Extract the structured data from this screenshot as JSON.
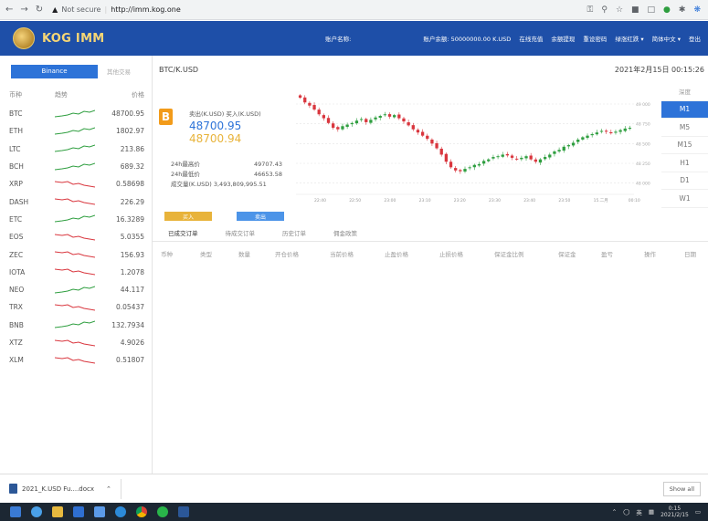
{
  "browser": {
    "security": "Not secure",
    "url": "http://imm.kog.one"
  },
  "header": {
    "brand": "KOG IMM",
    "account_label": "账户名称:",
    "balance": "账户余额: 50000000.00 K.USD",
    "links": [
      "在线充值",
      "余额提现",
      "重设密码",
      "绿涨红跌 ▾",
      "简体中文 ▾",
      "登出"
    ]
  },
  "sidebar": {
    "tab_active": "Binance",
    "tab_other": "其他交易",
    "columns": [
      "币种",
      "趋势",
      "价格"
    ],
    "rows": [
      {
        "coin": "BTC",
        "price": "48700.95",
        "trend": "up"
      },
      {
        "coin": "ETH",
        "price": "1802.97",
        "trend": "up"
      },
      {
        "coin": "LTC",
        "price": "213.86",
        "trend": "up"
      },
      {
        "coin": "BCH",
        "price": "689.32",
        "trend": "up"
      },
      {
        "coin": "XRP",
        "price": "0.58698",
        "trend": "down"
      },
      {
        "coin": "DASH",
        "price": "226.29",
        "trend": "down"
      },
      {
        "coin": "ETC",
        "price": "16.3289",
        "trend": "up"
      },
      {
        "coin": "EOS",
        "price": "5.0355",
        "trend": "down"
      },
      {
        "coin": "ZEC",
        "price": "156.93",
        "trend": "down"
      },
      {
        "coin": "IOTA",
        "price": "1.2078",
        "trend": "down"
      },
      {
        "coin": "NEO",
        "price": "44.117",
        "trend": "up"
      },
      {
        "coin": "TRX",
        "price": "0.05437",
        "trend": "down"
      },
      {
        "coin": "BNB",
        "price": "132.7934",
        "trend": "up"
      },
      {
        "coin": "XTZ",
        "price": "4.9026",
        "trend": "down"
      },
      {
        "coin": "XLM",
        "price": "0.51807",
        "trend": "down"
      }
    ]
  },
  "main": {
    "pair": "BTC/K.USD",
    "datetime": "2021年2月15日 00:15:26",
    "ticker": {
      "labels": "卖出(K.USD)    买入(K.USD)",
      "sell": "48700.95",
      "buy": "48700.94",
      "high_label": "24h最高价",
      "high": "49707.43",
      "low_label": "24h最低价",
      "low": "46653.58",
      "volume": "成交量(K.USD) 3,493,809,995.51"
    },
    "periods": [
      "深度",
      "M1",
      "M5",
      "M15",
      "H1",
      "D1",
      "W1"
    ],
    "active_period": "M1",
    "buy_btn": "买入",
    "sell_btn": "卖出",
    "order_tabs": [
      "已成交订单",
      "待成交订单",
      "历史订单",
      "佣金政策"
    ],
    "order_columns": [
      "币种",
      "类型",
      "数量",
      "开仓价格",
      "当前价格",
      "止盈价格",
      "止损价格",
      "保证金比例",
      "保证金",
      "盈亏",
      "操作",
      "日期"
    ]
  },
  "chart_data": {
    "type": "candlestick",
    "x_ticks": [
      "22:40",
      "22:50",
      "23:00",
      "23:10",
      "23:20",
      "23:30",
      "23:40",
      "23:50",
      "15.二月",
      "00:10"
    ],
    "y_ticks": [
      "49 000",
      "48 750",
      "48 500",
      "48 250",
      "48 000"
    ],
    "ylim": [
      47950,
      49150
    ],
    "series": [
      {
        "values": [
          49080,
          49020,
          48980,
          48930,
          48870,
          48820,
          48760,
          48700,
          48680,
          48720,
          48740,
          48760,
          48790,
          48810,
          48770,
          48800,
          48830,
          48850,
          48870,
          48840,
          48860,
          48820,
          48780,
          48730,
          48680,
          48640,
          48600,
          48560,
          48500,
          48440,
          48360,
          48270,
          48200,
          48160,
          48150,
          48180,
          48200,
          48230,
          48240,
          48280,
          48300,
          48330,
          48340,
          48360,
          48350,
          48320,
          48300,
          48320,
          48340,
          48300,
          48270,
          48300,
          48330,
          48360,
          48400,
          48420,
          48460,
          48480,
          48510,
          48550,
          48580,
          48600,
          48620,
          48640,
          48660,
          48650,
          48630,
          48650,
          48670,
          48690,
          48700
        ]
      }
    ]
  },
  "download": {
    "file": "2021_K.USD Fu....docx",
    "show_all": "Show all"
  },
  "taskbar": {
    "time": "0:15",
    "date": "2021/2/15",
    "ime": "英"
  },
  "colors": {
    "brand_blue": "#1e4fa8",
    "accent": "#2d73d8",
    "up": "#2e9e3f",
    "down": "#d9363e"
  }
}
